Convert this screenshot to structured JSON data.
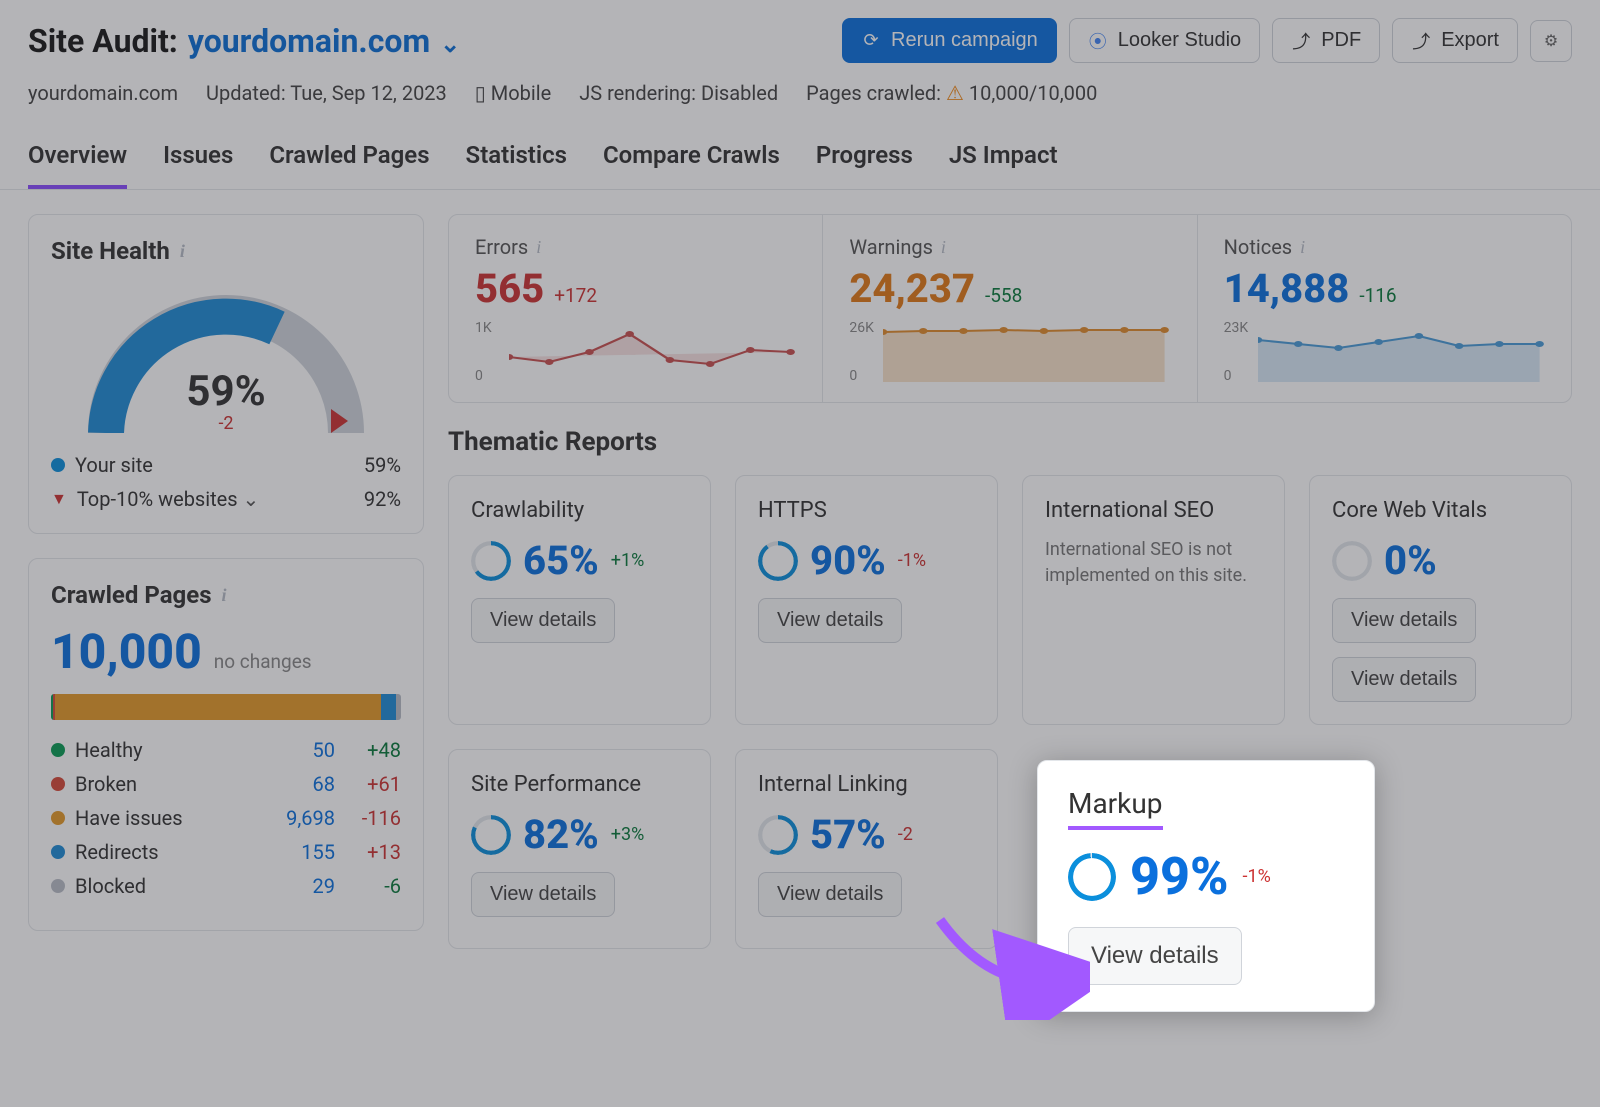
{
  "header": {
    "title_label": "Site Audit:",
    "domain": "yourdomain.com",
    "actions": {
      "rerun": "Rerun campaign",
      "looker": "Looker Studio",
      "pdf": "PDF",
      "export": "Export"
    }
  },
  "meta": {
    "domain": "yourdomain.com",
    "updated_label": "Updated: Tue, Sep 12, 2023",
    "mobile": "Mobile",
    "js": "JS rendering: Disabled",
    "pages_label": "Pages crawled:",
    "pages_value": "10,000/10,000"
  },
  "tabs": [
    "Overview",
    "Issues",
    "Crawled Pages",
    "Statistics",
    "Compare Crawls",
    "Progress",
    "JS Impact"
  ],
  "active_tab": 0,
  "site_health": {
    "title": "Site Health",
    "value": "59%",
    "delta": "-2",
    "legend": [
      {
        "label": "Your site",
        "value": "59%",
        "color": "#0b8fdc",
        "shape": "dot"
      },
      {
        "label": "Top-10% websites",
        "value": "92%",
        "color": "#c33",
        "shape": "triangle"
      }
    ]
  },
  "crawled_pages": {
    "title": "Crawled Pages",
    "total": "10,000",
    "changes": "no changes",
    "rows": [
      {
        "label": "Healthy",
        "n": "50",
        "d": "+48",
        "color": "#0a9b55",
        "dpos": true
      },
      {
        "label": "Broken",
        "n": "68",
        "d": "+61",
        "color": "#d64a3a",
        "dpos": false
      },
      {
        "label": "Have issues",
        "n": "9,698",
        "d": "-116",
        "color": "#e39a2a",
        "dpos": false
      },
      {
        "label": "Redirects",
        "n": "155",
        "d": "+13",
        "color": "#1f8cd6",
        "dpos": false
      },
      {
        "label": "Blocked",
        "n": "29",
        "d": "-6",
        "color": "#b8bec7",
        "dpos": true
      }
    ],
    "bar_pct": [
      0.5,
      0.7,
      93.0,
      4.5,
      1.3
    ]
  },
  "stats": {
    "errors": {
      "title": "Errors",
      "value": "565",
      "delta": "+172",
      "ymax": "1K",
      "y0": "0"
    },
    "warnings": {
      "title": "Warnings",
      "value": "24,237",
      "delta": "-558",
      "ymax": "26K",
      "y0": "0"
    },
    "notices": {
      "title": "Notices",
      "value": "14,888",
      "delta": "-116",
      "ymax": "23K",
      "y0": "0"
    }
  },
  "thematic": {
    "title": "Thematic Reports",
    "view_details": "View details",
    "cards": [
      {
        "key": "crawlability",
        "title": "Crawlability",
        "value": "65%",
        "delta": "+1%",
        "dpos": true,
        "pct": 65,
        "color": "#0b8fdc"
      },
      {
        "key": "https",
        "title": "HTTPS",
        "value": "90%",
        "delta": "-1%",
        "dpos": false,
        "pct": 90,
        "color": "#0b8fdc"
      },
      {
        "key": "intl",
        "title": "International SEO",
        "note": "International SEO is not implemented on this site."
      },
      {
        "key": "cwv",
        "title": "Core Web Vitals",
        "value": "0%",
        "pct": 0,
        "color": "#b8bec7"
      },
      {
        "key": "perf",
        "title": "Site Performance",
        "value": "82%",
        "delta": "+3%",
        "dpos": true,
        "pct": 82,
        "color": "#0b8fdc"
      },
      {
        "key": "linking",
        "title": "Internal Linking",
        "value": "57%",
        "delta": "-2",
        "dpos": false,
        "pct": 57,
        "color": "#0b8fdc"
      }
    ],
    "highlight": {
      "title": "Markup",
      "value": "99%",
      "delta": "-1%",
      "dpos": false,
      "pct": 99,
      "color": "#0b8fdc"
    }
  },
  "chart_data": [
    {
      "type": "line",
      "title": "Errors",
      "ylim": [
        0,
        1000
      ],
      "values": [
        420,
        380,
        500,
        700,
        450,
        400,
        540,
        560
      ]
    },
    {
      "type": "area",
      "title": "Warnings",
      "ylim": [
        0,
        26000
      ],
      "values": [
        23500,
        23800,
        23900,
        24000,
        23800,
        24100,
        24200,
        24237
      ]
    },
    {
      "type": "area",
      "title": "Notices",
      "ylim": [
        0,
        23000
      ],
      "values": [
        15500,
        14800,
        14200,
        15100,
        16100,
        14700,
        14900,
        14888
      ]
    }
  ]
}
